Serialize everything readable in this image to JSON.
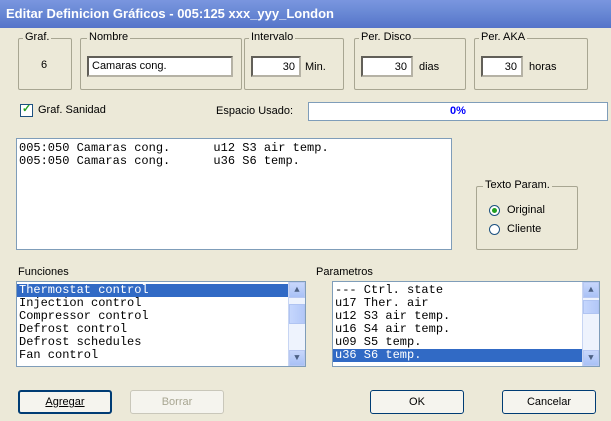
{
  "window": {
    "title": "Editar Definicion Gráficos - 005:125  xxx_yyy_London"
  },
  "fields": {
    "graf": {
      "label": "Graf.",
      "value": "6"
    },
    "nombre": {
      "label": "Nombre",
      "value": "Camaras cong."
    },
    "intervalo": {
      "label": "Intervalo",
      "value": "30",
      "unit": "Min."
    },
    "per_disco": {
      "label": "Per. Disco",
      "value": "30",
      "unit": "dias"
    },
    "per_aka": {
      "label": "Per. AKA",
      "value": "30",
      "unit": "horas"
    }
  },
  "graf_sanidad": {
    "label": "Graf. Sanidad",
    "checked": true
  },
  "espacio": {
    "label": "Espacio Usado:",
    "value": "0%"
  },
  "selected_params": [
    "005:050 Camaras cong.      u12 S3 air temp.",
    "005:050 Camaras cong.      u36 S6 temp."
  ],
  "texto_param": {
    "label": "Texto Param.",
    "original": "Original",
    "cliente": "Cliente",
    "selected": "Original"
  },
  "funciones": {
    "label": "Funciones",
    "items": [
      "Thermostat control",
      "Injection control",
      "Compressor control",
      "Defrost control",
      "Defrost schedules",
      "Fan control"
    ],
    "selected_index": 0
  },
  "parametros": {
    "label": "Parametros",
    "items": [
      "--- Ctrl. state",
      "u17 Ther. air",
      "u12 S3 air temp.",
      "u16 S4 air temp.",
      "u09 S5 temp.",
      "u36 S6 temp."
    ],
    "selected_index": 5
  },
  "buttons": {
    "agregar": "Agregar",
    "borrar": "Borrar",
    "ok": "OK",
    "cancelar": "Cancelar"
  }
}
